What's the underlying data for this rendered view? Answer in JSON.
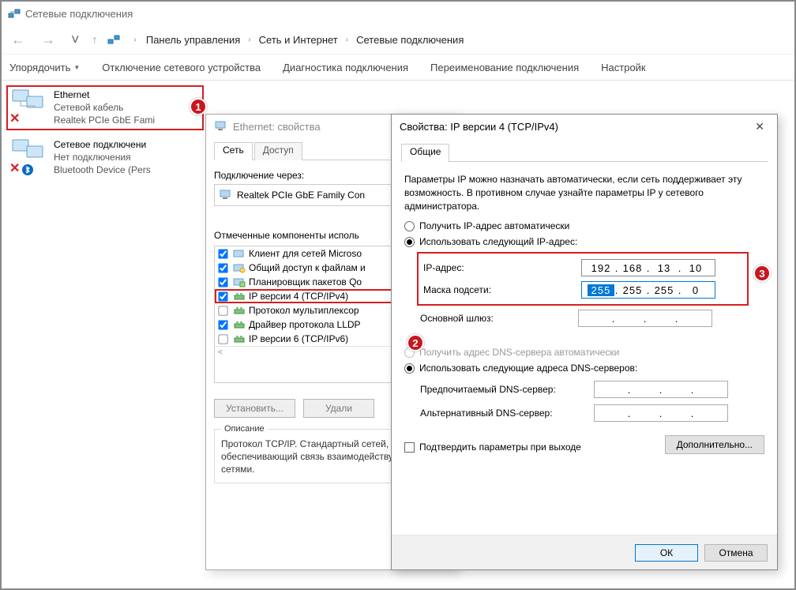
{
  "window": {
    "title": "Сетевые подключения"
  },
  "breadcrumb": [
    "Панель управления",
    "Сеть и Интернет",
    "Сетевые подключения"
  ],
  "toolbar": {
    "organize": "Упорядочить",
    "disable": "Отключение сетевого устройства",
    "diagnose": "Диагностика подключения",
    "rename": "Переименование подключения",
    "settings": "Настройк"
  },
  "connections": [
    {
      "title": "Ethernet",
      "line2": "Сетевой кабель",
      "line3": "Realtek PCIe GbE Fami",
      "highlight": true
    },
    {
      "title": "Сетевое подключени",
      "line2": "Нет подключения",
      "line3": "Bluetooth Device (Pers",
      "highlight": false
    }
  ],
  "eth_dialog": {
    "title": "Ethernet: свойства",
    "tabs": {
      "network": "Сеть",
      "access": "Доступ"
    },
    "connect_via_label": "Подключение через:",
    "adapter": "Realtek PCIe GbE Family Con",
    "components_label": "Отмеченные компоненты исполь",
    "components": [
      {
        "checked": true,
        "label": "Клиент для сетей Microso",
        "icon": "client"
      },
      {
        "checked": true,
        "label": "Общий доступ к файлам и",
        "icon": "share"
      },
      {
        "checked": true,
        "label": "Планировщик пакетов Qo",
        "icon": "qos"
      },
      {
        "checked": true,
        "label": "IP версии 4 (TCP/IPv4)",
        "icon": "proto",
        "highlight": true
      },
      {
        "checked": false,
        "label": "Протокол мультиплексор",
        "icon": "proto"
      },
      {
        "checked": true,
        "label": "Драйвер протокола LLDP",
        "icon": "proto"
      },
      {
        "checked": false,
        "label": "IP версии 6 (TCP/IPv6)",
        "icon": "proto"
      }
    ],
    "install_btn": "Установить...",
    "uninstall_btn": "Удали",
    "desc_legend": "Описание",
    "desc_text": "Протокол TCP/IP. Стандартный сетей, обеспечивающий связь взаимодействующими сетями."
  },
  "ip_dialog": {
    "title": "Свойства: IP версии 4 (TCP/IPv4)",
    "tab": "Общие",
    "info": "Параметры IP можно назначать автоматически, если сеть поддерживает эту возможность. В противном случае узнайте параметры IP у сетевого администратора.",
    "radio_auto_ip": "Получить IP-адрес автоматически",
    "radio_manual_ip": "Использовать следующий IP-адрес:",
    "lbl_ip": "IP-адрес:",
    "lbl_mask": "Маска подсети:",
    "lbl_gw": "Основной шлюз:",
    "ip": [
      "192",
      "168",
      "13",
      "10"
    ],
    "mask": [
      "255",
      "255",
      "255",
      "0"
    ],
    "mask_selected_seg": 0,
    "gw": [
      "",
      "",
      "",
      ""
    ],
    "radio_auto_dns": "Получить адрес DNS-сервера автоматически",
    "radio_manual_dns": "Использовать следующие адреса DNS-серверов:",
    "lbl_dns1": "Предпочитаемый DNS-сервер:",
    "lbl_dns2": "Альтернативный DNS-сервер:",
    "dns1": [
      "",
      "",
      "",
      ""
    ],
    "dns2": [
      "",
      "",
      "",
      ""
    ],
    "chk_validate": "Подтвердить параметры при выходе",
    "btn_advanced": "Дополнительно...",
    "btn_ok": "ОК",
    "btn_cancel": "Отмена"
  },
  "steps": {
    "s1": "1",
    "s2": "2",
    "s3": "3"
  }
}
